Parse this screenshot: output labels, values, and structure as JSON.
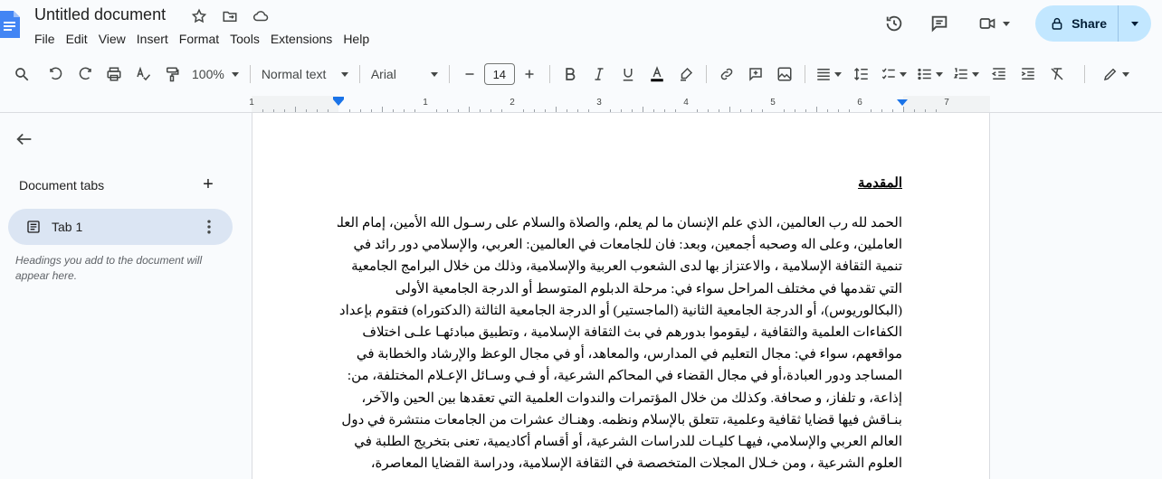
{
  "header": {
    "title": "Untitled document",
    "menu": [
      "File",
      "Edit",
      "View",
      "Insert",
      "Format",
      "Tools",
      "Extensions",
      "Help"
    ],
    "share_label": "Share"
  },
  "toolbar": {
    "zoom": "100%",
    "style": "Normal text",
    "font": "Arial",
    "font_size": "14"
  },
  "ruler": {
    "numbers": [
      "1",
      "1",
      "2",
      "3",
      "4",
      "5",
      "6",
      "7"
    ]
  },
  "sidebar": {
    "title": "Document tabs",
    "tab_label": "Tab 1",
    "hint": "Headings you add to the document will appear here."
  },
  "document": {
    "heading": "المقدمة",
    "lines": [
      "الحمد لله رب العالمين، الذي علم الإنسان ما لم يعلم، والصلاة والسلام على رسـول الله الأمين، إمام العلماء",
      "العاملين، وعلى اله وصحبه أجمعين، وبعد: فان للجامعات في العالمين: العربي، والإسلامي دور رائد في",
      "تنمية الثقافة الإسلامية ، والاعتزاز بها لدى الشعوب العربية والإسلامية، وذلك من خلال البرامج الجامعية",
      "التي تقدمها في مختلف المراحل سواء في: مرحلة الدبلوم المتوسط أو الدرجة الجامعية الأولى",
      "(البكالوريوس)، أو الدرجة الجامعية الثانية (الماجستير) أو الدرجة الجامعية الثالثة (الدكتوراه) فتقوم بإعداد",
      "الكفاءات العلمية والثقافية ، ليقوموا بدورهم في بث الثقافة الإسلامية ، وتطبيق مبادئهـا علـى اختلاف",
      "مواقعهم، سواء في: مجال التعليم في المدارس، والمعاهد، أو في مجال الوعظ والإرشاد والخطابة في",
      "المساجد ودور العبادة،أو في مجال القضاء في المحاكم الشرعية، أو فـي وسـائل الإعـلام المختلفة، من:",
      "إذاعة، و تلفاز، و صحافة. وكذلك من خلال المؤتمرات والندوات العلمية التي تعقدها بين الحين والآخر،",
      "بنـاقش فيها قضايا ثقافية وعلمية، تتعلق بالإسلام ونظمه. وهنـاك عشرات من الجامعات منتشرة في دول",
      "العالم العربي والإسلامي، فيهـا كليـات للدراسات الشرعية، أو أقسام أكاديمية، تعنى بتخريج الطلبة في",
      "العلوم الشرعية ، ومن خـلال المجلات المتخصصة في الثقافة الإسلامية، ودراسة القضايا المعاصرة،"
    ]
  },
  "colors": {
    "share_bg": "#c2e7ff",
    "tab_bg": "#dbe5f3",
    "docs_blue": "#4285f4",
    "ruler_marker": "#1a73e8"
  }
}
